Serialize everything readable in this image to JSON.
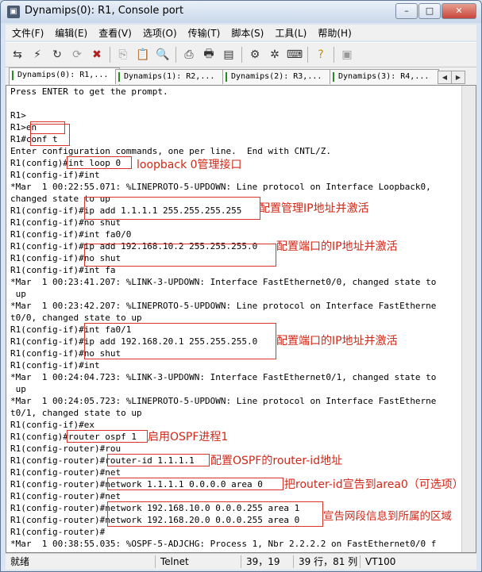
{
  "window": {
    "title": "Dynamips(0): R1, Console port"
  },
  "menu": [
    "文件(F)",
    "编辑(E)",
    "查看(V)",
    "选项(O)",
    "传输(T)",
    "脚本(S)",
    "工具(L)",
    "帮助(H)"
  ],
  "toolbar": {
    "icons": [
      "connect-icon",
      "quick-connect-icon",
      "reconnect-icon",
      "reconnect-all-icon",
      "disconnect-icon",
      "copy-icon",
      "paste-icon",
      "find-icon",
      "print-setup-icon",
      "print-icon",
      "print-screen-icon",
      "session-options-icon",
      "global-options-icon",
      "keymap-icon",
      "help-icon",
      "lock-icon"
    ]
  },
  "tabs": [
    "Dynamips(0): R1,...",
    "Dynamips(1): R2,...",
    "Dynamips(2): R3,...",
    "Dynamips(3): R4,..."
  ],
  "console": {
    "lines": [
      "Press ENTER to get the prompt.",
      "",
      "R1>",
      "R1>en",
      "R1#conf t",
      "Enter configuration commands, one per line.  End with CNTL/Z.",
      "R1(config)#int loop 0",
      "R1(config-if)#int",
      "*Mar  1 00:22:55.071: %LINEPROTO-5-UPDOWN: Line protocol on Interface Loopback0,",
      "changed state to up",
      "R1(config-if)#ip add 1.1.1.1 255.255.255.255",
      "R1(config-if)#no shut",
      "R1(config-if)#int fa0/0",
      "R1(config-if)#ip add 192.168.10.2 255.255.255.0",
      "R1(config-if)#no shut",
      "R1(config-if)#int fa",
      "*Mar  1 00:23:41.207: %LINK-3-UPDOWN: Interface FastEthernet0/0, changed state to",
      " up",
      "*Mar  1 00:23:42.207: %LINEPROTO-5-UPDOWN: Line protocol on Interface FastEtherne",
      "t0/0, changed state to up",
      "R1(config-if)#int fa0/1",
      "R1(config-if)#ip add 192.168.20.1 255.255.255.0",
      "R1(config-if)#no shut",
      "R1(config-if)#int",
      "*Mar  1 00:24:04.723: %LINK-3-UPDOWN: Interface FastEthernet0/1, changed state to",
      " up",
      "*Mar  1 00:24:05.723: %LINEPROTO-5-UPDOWN: Line protocol on Interface FastEtherne",
      "t0/1, changed state to up",
      "R1(config-if)#ex",
      "R1(config)#router ospf 1",
      "R1(config-router)#rou",
      "R1(config-router)#router-id 1.1.1.1",
      "R1(config-router)#net",
      "R1(config-router)#network 1.1.1.1 0.0.0.0 area 0",
      "R1(config-router)#net",
      "R1(config-router)#network 192.168.10.0 0.0.0.255 area 1",
      "R1(config-router)#network 192.168.20.0 0.0.0.255 area 0",
      "R1(config-router)#",
      "*Mar  1 00:38:55.035: %OSPF-5-ADJCHG: Process 1, Nbr 2.2.2.2 on FastEthernet0/0 f"
    ]
  },
  "annotations": [
    "loopback 0管理接口",
    "配置管理IP地址并激活",
    "配置端口的IP地址并激活",
    "配置端口的IP地址并激活",
    "启用OSPF进程1",
    "配置OSPF的router-id地址",
    "把router-id宣告到area0（可选项）",
    "宣告网段信息到所属的区域"
  ],
  "status": {
    "ready": "就绪",
    "protocol": "Telnet",
    "cursor": "39，19",
    "size": "39 行，81 列",
    "emulation": "VT100"
  },
  "colors": {
    "annotation": "#d02818",
    "title_bar": "#c9d8ea"
  }
}
